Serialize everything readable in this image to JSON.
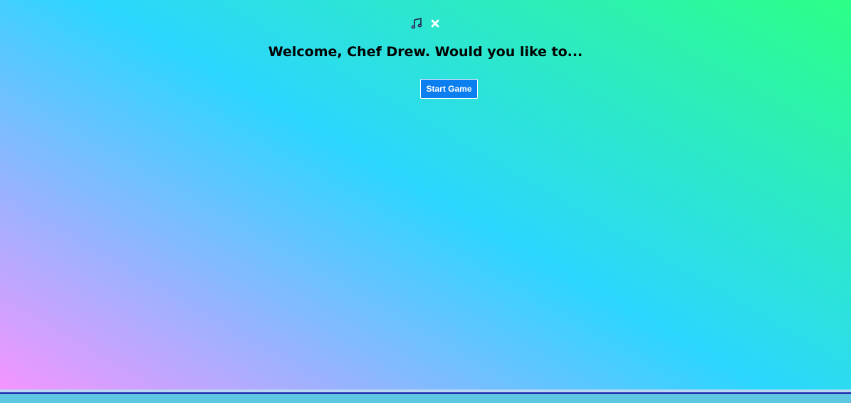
{
  "top_controls": {
    "music_icon": "music-note-icon",
    "close_icon": "close-icon"
  },
  "welcome": {
    "text": "Welcome, Chef Drew. Would you like to..."
  },
  "actions": {
    "start_game_label": "Start Game"
  },
  "colors": {
    "gradient_start": "#f495fe",
    "gradient_mid": "#2cd6ff",
    "gradient_end": "#2cff86",
    "button_bg": "#0b7ff0",
    "button_text": "#ffffff"
  }
}
